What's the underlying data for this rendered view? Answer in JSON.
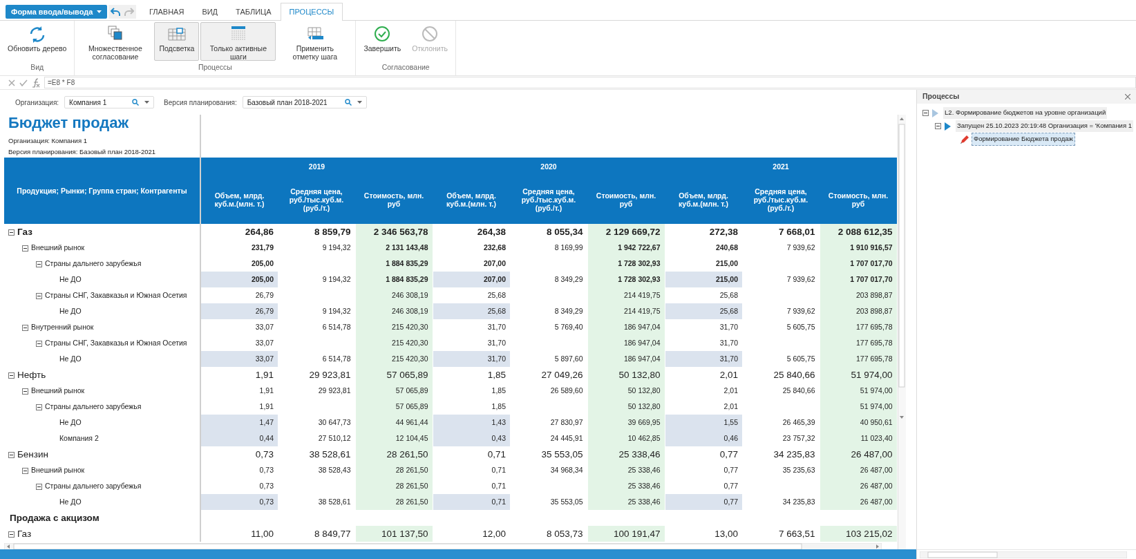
{
  "toolbar": {
    "form_button": "Форма ввода/вывода",
    "undo_disabled": false,
    "redo_disabled": true
  },
  "tabs": [
    {
      "label": "ГЛАВНАЯ",
      "selected": false
    },
    {
      "label": "ВИД",
      "selected": false
    },
    {
      "label": "ТАБЛИЦА",
      "selected": false
    },
    {
      "label": "ПРОЦЕССЫ",
      "selected": true
    }
  ],
  "ribbon": {
    "groups": [
      {
        "label": "Вид",
        "buttons": [
          {
            "label": "Обновить дерево",
            "kind": "refresh",
            "pressed": false,
            "disabled": false
          }
        ]
      },
      {
        "label": "Процессы",
        "buttons": [
          {
            "label": "Множественное согласование",
            "kind": "multi",
            "pressed": false,
            "disabled": false
          },
          {
            "label": "Подсветка",
            "kind": "highlight",
            "pressed": true,
            "disabled": false
          },
          {
            "label": "Только активные шаги",
            "kind": "active-steps",
            "pressed": true,
            "disabled": false
          },
          {
            "label": "Применить отметку шага",
            "kind": "apply-mark",
            "pressed": false,
            "disabled": false
          }
        ]
      },
      {
        "label": "Согласование",
        "buttons": [
          {
            "label": "Завершить",
            "kind": "complete",
            "pressed": false,
            "disabled": false
          },
          {
            "label": "Отклонить",
            "kind": "reject",
            "pressed": false,
            "disabled": true
          }
        ]
      }
    ]
  },
  "formula_bar": {
    "value": "=E8 * F8"
  },
  "filters": [
    {
      "label": "Организация:",
      "value": "Компания 1"
    },
    {
      "label": "Версия планирования:",
      "value": "Базовый план 2018-2021"
    }
  ],
  "report": {
    "title": "Бюджет продаж",
    "subtitles": [
      "Организация: Компания 1",
      "Версия планирования: Базовый план 2018-2021"
    ]
  },
  "table": {
    "row_header": "Продукция; Рынки; Группа стран; Контрагенты",
    "years": [
      {
        "label": "2019",
        "columns": [
          {
            "label": "Объем, млрд. куб.м.(млн. т.)",
            "kind": "volume"
          },
          {
            "label": "Средняя цена, руб./тыс.куб.м. (руб./т.)",
            "kind": "price"
          },
          {
            "label": "Стоимость, млн. руб",
            "kind": "cost"
          }
        ]
      },
      {
        "label": "2020",
        "columns": [
          {
            "label": "Объем, млрд. куб.м.(млн. т.)",
            "kind": "volume"
          },
          {
            "label": "Средняя цена, руб./тыс.куб.м. (руб./т.)",
            "kind": "price"
          },
          {
            "label": "Стоимость, млн. руб",
            "kind": "cost"
          }
        ]
      },
      {
        "label": "2021",
        "columns": [
          {
            "label": "Объем, млрд. куб.м.(млн. т.)",
            "kind": "volume"
          },
          {
            "label": "Средняя цена, руб./тыс.куб.м. (руб./т.)",
            "kind": "price"
          },
          {
            "label": "Стоимость, млн. руб",
            "kind": "cost"
          }
        ]
      }
    ],
    "rows": [
      {
        "label": "Газ",
        "kind": "group",
        "expanded": true,
        "emphasis": true,
        "cells": [
          {
            "volume": "264,86",
            "price": "8 859,79",
            "cost": "2 346 563,78"
          },
          {
            "volume": "264,38",
            "price": "8 055,34",
            "cost": "2 129 669,72"
          },
          {
            "volume": "272,38",
            "price": "7 668,01",
            "cost": "2 088 612,35"
          }
        ],
        "children": [
          {
            "label": "Внешний рынок",
            "kind": "group",
            "expanded": true,
            "emphasis": true,
            "cells": [
              {
                "volume": "231,79",
                "price": "9 194,32",
                "cost": "2 131 143,48"
              },
              {
                "volume": "232,68",
                "price": "8 169,99",
                "cost": "1 942 722,67"
              },
              {
                "volume": "240,68",
                "price": "7 939,62",
                "cost": "1 910 916,57"
              }
            ],
            "children": [
              {
                "label": "Страны дальнего зарубежья",
                "kind": "group",
                "expanded": true,
                "emphasis": true,
                "cells": [
                  {
                    "volume": "205,00",
                    "cost": "1 884 835,29"
                  },
                  {
                    "volume": "207,00",
                    "cost": "1 728 302,93"
                  },
                  {
                    "volume": "215,00",
                    "cost": "1 707 017,70"
                  }
                ],
                "children": [
                  {
                    "label": "Не ДО",
                    "kind": "leaf",
                    "emphasis": true,
                    "cells": [
                      {
                        "volume": "205,00",
                        "price": "9 194,32",
                        "cost": "1 884 835,29"
                      },
                      {
                        "volume": "207,00",
                        "price": "8 349,29",
                        "cost": "1 728 302,93"
                      },
                      {
                        "volume": "215,00",
                        "price": "7 939,62",
                        "cost": "1 707 017,70"
                      }
                    ]
                  }
                ]
              },
              {
                "label": "Страны СНГ, Закавказья и Южная Осетия",
                "kind": "group",
                "expanded": true,
                "emphasis": false,
                "cells": [
                  {
                    "volume": "26,79",
                    "cost": "246 308,19"
                  },
                  {
                    "volume": "25,68",
                    "cost": "214 419,75"
                  },
                  {
                    "volume": "25,68",
                    "cost": "203 898,87"
                  }
                ],
                "children": [
                  {
                    "label": "Не ДО",
                    "kind": "leaf",
                    "emphasis": false,
                    "cells": [
                      {
                        "volume": "26,79",
                        "price": "9 194,32",
                        "cost": "246 308,19"
                      },
                      {
                        "volume": "25,68",
                        "price": "8 349,29",
                        "cost": "214 419,75"
                      },
                      {
                        "volume": "25,68",
                        "price": "7 939,62",
                        "cost": "203 898,87"
                      }
                    ]
                  }
                ]
              }
            ]
          },
          {
            "label": "Внутренний рынок",
            "kind": "group",
            "expanded": true,
            "emphasis": false,
            "cells": [
              {
                "volume": "33,07",
                "price": "6 514,78",
                "cost": "215 420,30"
              },
              {
                "volume": "31,70",
                "price": "5 769,40",
                "cost": "186 947,04"
              },
              {
                "volume": "31,70",
                "price": "5 605,75",
                "cost": "177 695,78"
              }
            ],
            "children": [
              {
                "label": "Страны СНГ, Закавказья и Южная Осетия",
                "kind": "group",
                "expanded": true,
                "emphasis": false,
                "cells": [
                  {
                    "volume": "33,07",
                    "cost": "215 420,30"
                  },
                  {
                    "volume": "31,70",
                    "cost": "186 947,04"
                  },
                  {
                    "volume": "31,70",
                    "cost": "177 695,78"
                  }
                ],
                "children": [
                  {
                    "label": "Не ДО",
                    "kind": "leaf",
                    "emphasis": false,
                    "cells": [
                      {
                        "volume": "33,07",
                        "price": "6 514,78",
                        "cost": "215 420,30"
                      },
                      {
                        "volume": "31,70",
                        "price": "5 897,60",
                        "cost": "186 947,04"
                      },
                      {
                        "volume": "31,70",
                        "price": "5 605,75",
                        "cost": "177 695,78"
                      }
                    ]
                  }
                ]
              }
            ]
          }
        ]
      },
      {
        "label": "Нефть",
        "kind": "group",
        "expanded": true,
        "emphasis": false,
        "cells": [
          {
            "volume": "1,91",
            "price": "29 923,81",
            "cost": "57 065,89"
          },
          {
            "volume": "1,85",
            "price": "27 049,26",
            "cost": "50 132,80"
          },
          {
            "volume": "2,01",
            "price": "25 840,66",
            "cost": "51 974,00"
          }
        ],
        "children": [
          {
            "label": "Внешний рынок",
            "kind": "group",
            "expanded": true,
            "emphasis": false,
            "cells": [
              {
                "volume": "1,91",
                "price": "29 923,81",
                "cost": "57 065,89"
              },
              {
                "volume": "1,85",
                "price": "26 589,60",
                "cost": "50 132,80"
              },
              {
                "volume": "2,01",
                "price": "25 840,66",
                "cost": "51 974,00"
              }
            ],
            "children": [
              {
                "label": "Страны дальнего зарубежья",
                "kind": "group",
                "expanded": true,
                "emphasis": false,
                "cells": [
                  {
                    "volume": "1,91",
                    "cost": "57 065,89"
                  },
                  {
                    "volume": "1,85",
                    "cost": "50 132,80"
                  },
                  {
                    "volume": "2,01",
                    "cost": "51 974,00"
                  }
                ],
                "children": [
                  {
                    "label": "Не ДО",
                    "kind": "leaf",
                    "emphasis": false,
                    "cells": [
                      {
                        "volume": "1,47",
                        "price": "30 647,73",
                        "cost": "44 961,44"
                      },
                      {
                        "volume": "1,43",
                        "price": "27 830,97",
                        "cost": "39 669,95"
                      },
                      {
                        "volume": "1,55",
                        "price": "26 465,39",
                        "cost": "40 950,61"
                      }
                    ]
                  },
                  {
                    "label": "Компания 2",
                    "kind": "leaf",
                    "emphasis": false,
                    "cells": [
                      {
                        "volume": "0,44",
                        "price": "27 510,12",
                        "cost": "12 104,45"
                      },
                      {
                        "volume": "0,43",
                        "price": "24 445,91",
                        "cost": "10 462,85"
                      },
                      {
                        "volume": "0,46",
                        "price": "23 757,32",
                        "cost": "11 023,40"
                      }
                    ]
                  }
                ]
              }
            ]
          }
        ]
      },
      {
        "label": "Бензин",
        "kind": "group",
        "expanded": true,
        "emphasis": false,
        "cells": [
          {
            "volume": "0,73",
            "price": "38 528,61",
            "cost": "28 261,50"
          },
          {
            "volume": "0,71",
            "price": "35 553,05",
            "cost": "25 338,46"
          },
          {
            "volume": "0,77",
            "price": "34 235,83",
            "cost": "26 487,00"
          }
        ],
        "children": [
          {
            "label": "Внешний рынок",
            "kind": "group",
            "expanded": true,
            "emphasis": false,
            "cells": [
              {
                "volume": "0,73",
                "price": "38 528,43",
                "cost": "28 261,50"
              },
              {
                "volume": "0,71",
                "price": "34 968,34",
                "cost": "25 338,46"
              },
              {
                "volume": "0,77",
                "price": "35 235,63",
                "cost": "26 487,00"
              }
            ],
            "children": [
              {
                "label": "Страны дальнего зарубежья",
                "kind": "group",
                "expanded": true,
                "emphasis": false,
                "cells": [
                  {
                    "volume": "0,73",
                    "cost": "28 261,50"
                  },
                  {
                    "volume": "0,71",
                    "cost": "25 338,46"
                  },
                  {
                    "volume": "0,77",
                    "cost": "26 487,00"
                  }
                ],
                "children": [
                  {
                    "label": "Не ДО",
                    "kind": "leaf",
                    "emphasis": false,
                    "cells": [
                      {
                        "volume": "0,73",
                        "price": "38 528,61",
                        "cost": "28 261,50"
                      },
                      {
                        "volume": "0,71",
                        "price": "35 553,05",
                        "cost": "25 338,46"
                      },
                      {
                        "volume": "0,77",
                        "price": "34 235,83",
                        "cost": "26 487,00"
                      }
                    ]
                  }
                ]
              }
            ]
          }
        ]
      },
      {
        "label": "Продажа с акцизом",
        "kind": "section"
      },
      {
        "label": "Газ",
        "kind": "group",
        "expanded": true,
        "emphasis": false,
        "cells": [
          {
            "volume": "11,00",
            "price": "8 849,77",
            "cost": "101 137,50"
          },
          {
            "volume": "12,00",
            "price": "8 053,73",
            "cost": "100 191,47"
          },
          {
            "volume": "13,00",
            "price": "7 663,51",
            "cost": "103 215,02"
          }
        ]
      }
    ]
  },
  "processes_panel": {
    "title": "Процессы",
    "tree": [
      {
        "label": "L2. Формирование бюджетов на уровне организаций",
        "kind": "step",
        "expanded": true,
        "selected": false,
        "children": [
          {
            "label": "Запущен 25.10.2023 20:19:48 Организация = 'Компания 1",
            "kind": "run",
            "expanded": true,
            "selected": false,
            "children": [
              {
                "label": "Формирование Бюджета продаж",
                "kind": "task",
                "selected": true
              }
            ]
          }
        ]
      }
    ]
  }
}
